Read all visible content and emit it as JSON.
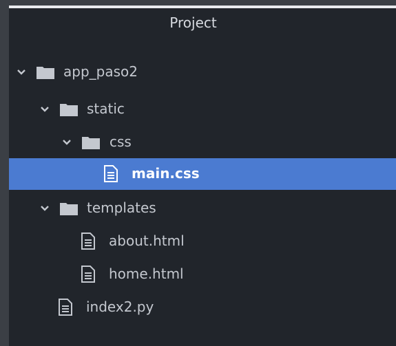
{
  "panel": {
    "title": "Project"
  },
  "tree": [
    {
      "label": "app_paso2",
      "type": "folder",
      "expanded": true
    },
    {
      "label": "static",
      "type": "folder",
      "expanded": true
    },
    {
      "label": "css",
      "type": "folder",
      "expanded": true
    },
    {
      "label": "main.css",
      "type": "file",
      "selected": true
    },
    {
      "label": "templates",
      "type": "folder",
      "expanded": true
    },
    {
      "label": "about.html",
      "type": "file"
    },
    {
      "label": "home.html",
      "type": "file"
    },
    {
      "label": "index2.py",
      "type": "file"
    }
  ],
  "colors": {
    "panel_bg": "#21252b",
    "selection": "#4b7bd1",
    "text": "#c4c8cf",
    "icon": "#c4c8cf"
  }
}
